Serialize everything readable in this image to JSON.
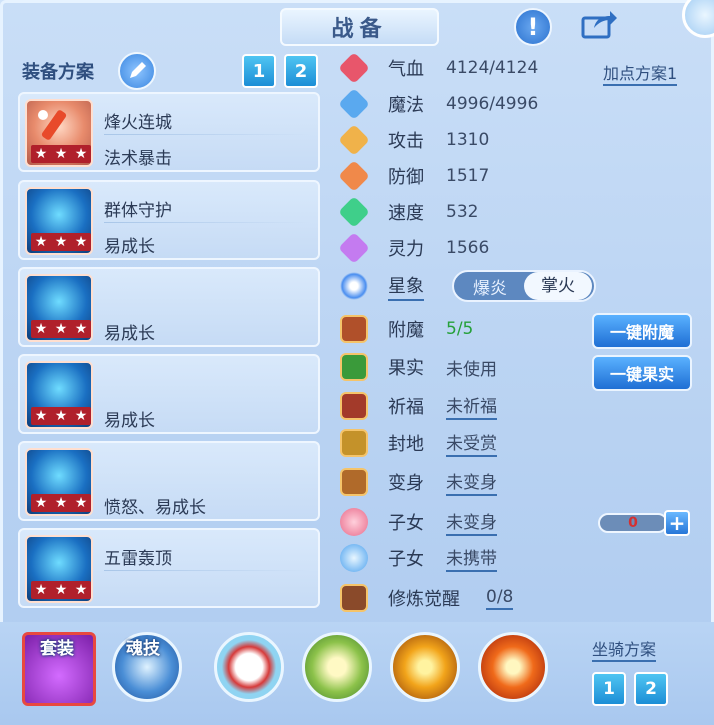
{
  "header": {
    "title": "战备"
  },
  "left": {
    "title": "装备方案",
    "plan_tabs": [
      "1",
      "2"
    ],
    "slots": [
      {
        "line1": "烽火连城",
        "line2": "法术暴击"
      },
      {
        "line1": "群体守护",
        "line2": "易成长"
      },
      {
        "line1": "",
        "line2": "易成长"
      },
      {
        "line1": "",
        "line2": "易成长"
      },
      {
        "line1": "",
        "line2": "愤怒、易成长"
      },
      {
        "line1": "五雷轰顶",
        "line2": ""
      }
    ]
  },
  "stats": {
    "plan_link": "加点方案1",
    "rows": [
      {
        "label": "气血",
        "value": "4124/4124"
      },
      {
        "label": "魔法",
        "value": "4996/4996"
      },
      {
        "label": "攻击",
        "value": "1310"
      },
      {
        "label": "防御",
        "value": "1517"
      },
      {
        "label": "速度",
        "value": "532"
      },
      {
        "label": "灵力",
        "value": "1566"
      }
    ],
    "star_label": "星象",
    "star_options": [
      "爆炎",
      "掌火"
    ]
  },
  "attachments": {
    "enchant": {
      "label": "附魔",
      "value": "5/5",
      "button": "一键附魔"
    },
    "fruit": {
      "label": "果实",
      "value": "未使用",
      "button": "一键果实"
    },
    "bless": {
      "label": "祈福",
      "value": "未祈福"
    },
    "fengdi": {
      "label": "封地",
      "value": "未受赏"
    },
    "transform": {
      "label": "变身",
      "value": "未变身"
    },
    "child1": {
      "label": "子女",
      "value": "未变身",
      "counter": "0",
      "plus": "+"
    },
    "child2": {
      "label": "子女",
      "value": "未携带"
    },
    "cultivate": {
      "label": "修炼觉醒",
      "value": "0/8"
    }
  },
  "bottom": {
    "suit_label": "套装",
    "soul_label": "魂技",
    "mount_label": "坐骑方案",
    "mount_tabs": [
      "1",
      "2"
    ]
  }
}
